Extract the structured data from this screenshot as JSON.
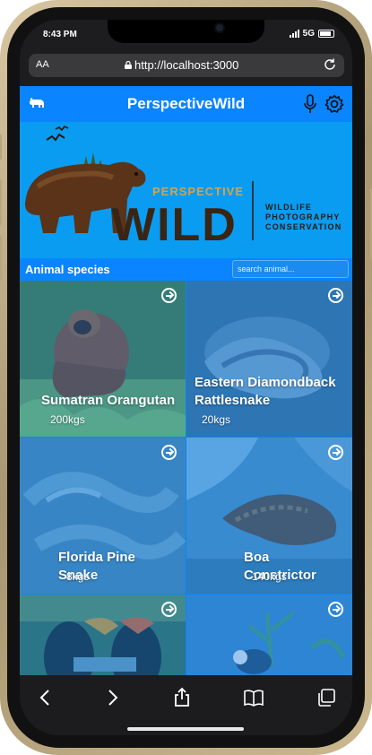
{
  "status": {
    "time": "8:43 PM",
    "network": "5G"
  },
  "browser": {
    "aa_label": "AA",
    "url": "http://localhost:3000"
  },
  "app": {
    "title": "PerspectiveWild",
    "hero": {
      "brand_small": "PERSPECTIVE",
      "brand_large": "WILD",
      "tagline": [
        "WILDLIFE",
        "PHOTOGRAPHY",
        "CONSERVATION"
      ]
    },
    "species_title": "Animal species",
    "search_placeholder": "search animal..."
  },
  "animals": [
    {
      "name": "Sumatran Orangutan",
      "weight": "200kgs"
    },
    {
      "name": "Eastern Diamondback Rattlesnake",
      "weight": "20kgs"
    },
    {
      "name": "Florida Pine Snake",
      "weight": "8kgs"
    },
    {
      "name": "Boa Constrictor",
      "weight": "140kgs"
    },
    {
      "name": "",
      "weight": ""
    },
    {
      "name": "",
      "weight": ""
    }
  ],
  "colors": {
    "accent": "#0a84ff",
    "hero": "#0a9cf0",
    "toolbar": "#1c1c1e"
  }
}
